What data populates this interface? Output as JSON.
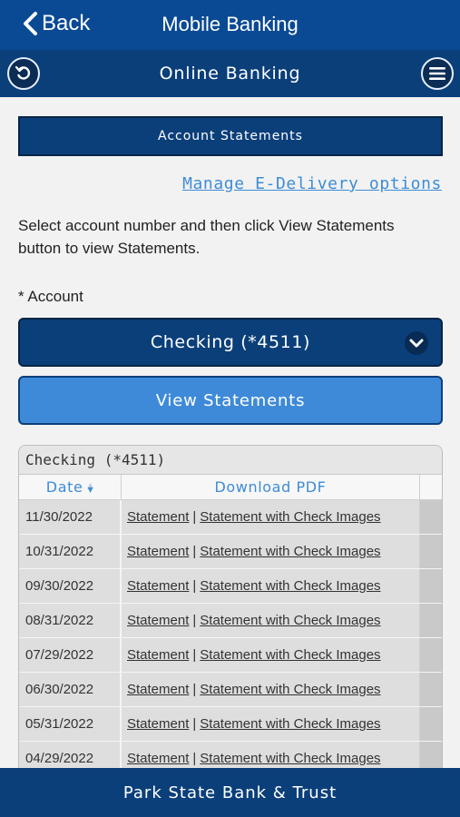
{
  "topbar": {
    "back_label": "Back",
    "title": "Mobile Banking"
  },
  "subbar": {
    "title": "Online Banking",
    "left_icon": "refresh-icon",
    "right_icon": "menu-icon"
  },
  "section": {
    "title": "Account Statements"
  },
  "manage_link": "Manage E-Delivery options",
  "instructions": "Select account number and then click View Statements button to view Statements.",
  "account_label": "* Account",
  "account_select": {
    "selected": "Checking (*4511)"
  },
  "view_button": "View Statements",
  "table": {
    "caption": "Checking (*4511)",
    "headers": {
      "date": "Date",
      "pdf": "Download PDF"
    },
    "rows": [
      {
        "date": "11/30/2022",
        "statement": "Statement",
        "with_images": "Statement with Check Images"
      },
      {
        "date": "10/31/2022",
        "statement": "Statement",
        "with_images": "Statement with Check Images"
      },
      {
        "date": "09/30/2022",
        "statement": "Statement",
        "with_images": "Statement with Check Images"
      },
      {
        "date": "08/31/2022",
        "statement": "Statement",
        "with_images": "Statement with Check Images"
      },
      {
        "date": "07/29/2022",
        "statement": "Statement",
        "with_images": "Statement with Check Images"
      },
      {
        "date": "06/30/2022",
        "statement": "Statement",
        "with_images": "Statement with Check Images"
      },
      {
        "date": "05/31/2022",
        "statement": "Statement",
        "with_images": "Statement with Check Images"
      },
      {
        "date": "04/29/2022",
        "statement": "Statement",
        "with_images": "Statement with Check Images"
      }
    ],
    "separator": "|"
  },
  "footer": "Park State Bank & Trust",
  "colors": {
    "header_blue": "#0a4a94",
    "dark_blue": "#0b3f7a",
    "accent_blue": "#3e8ad8",
    "link_blue": "#3d8cd6"
  }
}
